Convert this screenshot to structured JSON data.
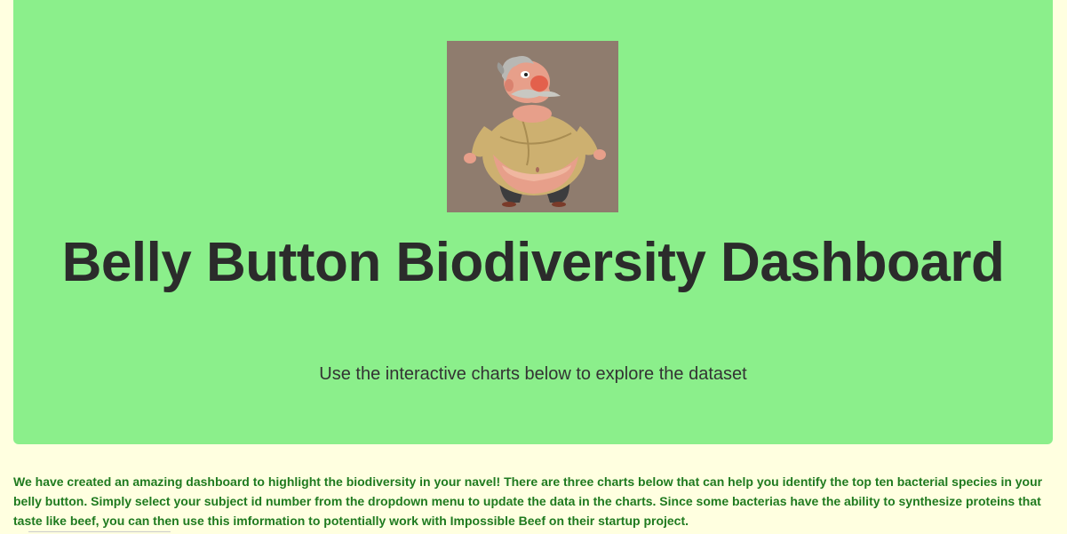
{
  "header": {
    "title": "Belly Button Biodiversity Dashboard",
    "subtitle": "Use the interactive charts below to explore the dataset",
    "image": "cartoon-man-belly-image"
  },
  "intro": {
    "text": "We have created an amazing dashboard to highlight the biodiversity in your navel! There are three charts below that can help you identify the top ten bacterial species in your belly button. Simply select your subject id number from the dropdown menu to update the data in the charts. Since some bacterias have the ability to synthesize proteins that taste like beef, you can then use this imformation to potentially work with Impossible Beef on their startup project."
  },
  "colors": {
    "page_background": "#ffffe0",
    "jumbotron_background": "#8bef8b",
    "intro_text": "#1f7a1f",
    "title_text": "#2b2b2b"
  }
}
